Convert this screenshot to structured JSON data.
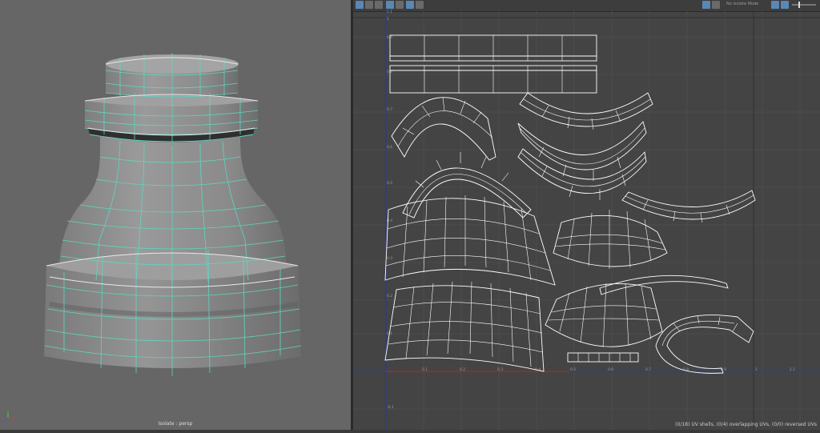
{
  "viewport_3d": {
    "label": "Isolate : persp"
  },
  "uv_editor": {
    "toolbar": {
      "isolate_label": "No Isolate Mode"
    },
    "axis_labels": {
      "u": [
        "0.1",
        "0.2",
        "0.3",
        "0.4",
        "0.5",
        "0.6",
        "0.7",
        "0.8",
        "0.9",
        "1",
        "1.1"
      ],
      "v": [
        "0.1",
        "0.2",
        "0.3",
        "0.4",
        "0.5",
        "0.6",
        "0.7",
        "0.8",
        "0.9",
        "1",
        "1.1"
      ],
      "v_neg": "-0.1"
    },
    "status": "(0/18) UV shells, (0/4) overlapping UVs, (0/0) reversed UVs"
  },
  "colors": {
    "mesh": "#8d8d8d",
    "edge": "#5fd6c0",
    "shell": "#ffffff",
    "u_axis": "#c03030",
    "v_axis": "#3040c0",
    "accent": "#5a87b6"
  }
}
